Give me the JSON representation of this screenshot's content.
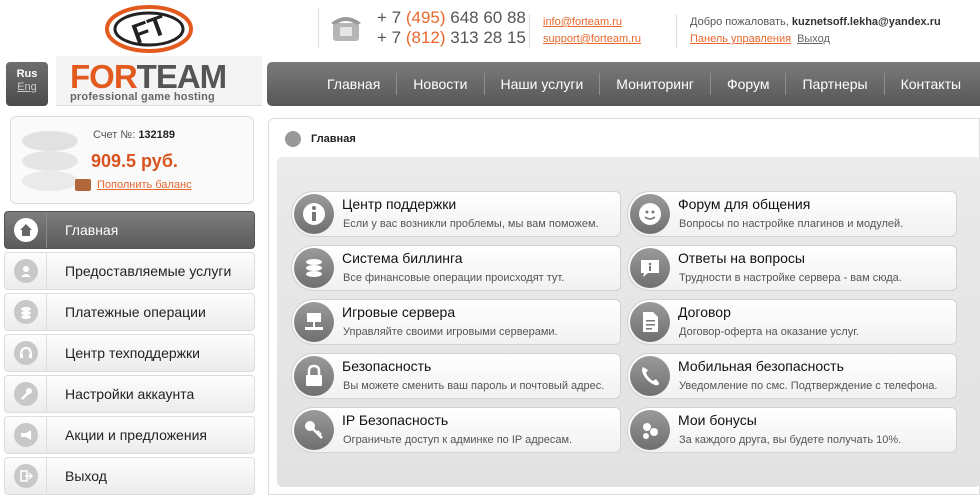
{
  "header": {
    "logo_letters": "FT",
    "phones": [
      {
        "prefix": "+ 7 ",
        "code": "(495)",
        "number": " 648 60 88"
      },
      {
        "prefix": "+ 7 ",
        "code": "(812)",
        "number": " 313 28 15"
      }
    ],
    "emails": [
      "info@forteam.ru",
      "support@forteam.ru"
    ],
    "welcome_text": "Добро пожаловать, ",
    "user_email": "kuznetsoff.lekha@yandex.ru",
    "control_panel": "Панель управления",
    "logout": "Выход"
  },
  "lang": {
    "current": "Rus",
    "other": "Eng"
  },
  "brand": {
    "for": "FOR",
    "team": "TEAM",
    "tagline": "professional game hosting"
  },
  "topnav": [
    "Главная",
    "Новости",
    "Наши услуги",
    "Мониторинг",
    "Форум",
    "Партнеры",
    "Контакты"
  ],
  "balance": {
    "account_label": "Счет №: ",
    "account_number": "132189",
    "amount": "909.5 руб.",
    "topup": "Пополнить баланс"
  },
  "sidenav": [
    {
      "label": "Главная",
      "icon": "home-icon",
      "active": true
    },
    {
      "label": "Предоставляемые услуги",
      "icon": "user-icon"
    },
    {
      "label": "Платежные операции",
      "icon": "coins-icon"
    },
    {
      "label": "Центр техподдержки",
      "icon": "headset-icon"
    },
    {
      "label": "Настройки аккаунта",
      "icon": "wrench-icon"
    },
    {
      "label": "Акции и предложения",
      "icon": "megaphone-icon"
    },
    {
      "label": "Выход",
      "icon": "exit-icon"
    }
  ],
  "main": {
    "breadcrumb": "Главная",
    "cards": [
      {
        "title": "Центр поддержки",
        "desc": "Если у вас возникли проблемы, мы вам поможем.",
        "icon": "info-icon"
      },
      {
        "title": "Форум для общения",
        "desc": "Вопросы по настройке плагинов и модулей.",
        "icon": "chat-icon"
      },
      {
        "title": "Система биллинга",
        "desc": "Все финансовые операции происходят тут.",
        "icon": "database-icon"
      },
      {
        "title": "Ответы на вопросы",
        "desc": "Трудности в настройке сервера - вам сюда.",
        "icon": "faq-icon"
      },
      {
        "title": "Игровые сервера",
        "desc": "Управляйте своими игровыми серверами.",
        "icon": "server-icon"
      },
      {
        "title": "Договор",
        "desc": "Договор-оферта на оказание услуг.",
        "icon": "document-icon"
      },
      {
        "title": "Безопасность",
        "desc": "Вы можете сменить ваш пароль и почтовый адрес.",
        "icon": "lock-icon"
      },
      {
        "title": "Мобильная безопасность",
        "desc": "Уведомление по смс. Подтверждение с телефона.",
        "icon": "phone-icon"
      },
      {
        "title": "IP Безопасность",
        "desc": "Ограничьте доступ к админке по IP адресам.",
        "icon": "key-icon"
      },
      {
        "title": "Мои бонусы",
        "desc": "За каждого друга, вы будете получать 10%.",
        "icon": "bonus-icon"
      }
    ]
  }
}
